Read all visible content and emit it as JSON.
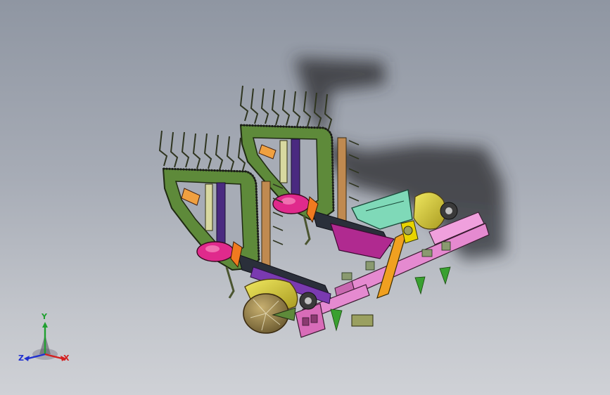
{
  "triad": {
    "x_label": "X",
    "y_label": "Y",
    "z_label": "Z",
    "x_color": "#d42020",
    "y_color": "#20a030",
    "z_color": "#2030d0"
  },
  "model": {
    "frame_color": "#5e8a3a",
    "outline_color": "#1f2a12",
    "chassis_color": "#e58ad0",
    "tine_color": "#4b5530",
    "belt_color": "#2a2f3a",
    "accent_yellow": "#e8d400",
    "accent_magenta": "#e02a8c",
    "accent_orange": "#f07a20",
    "accent_teal": "#7fd9b8",
    "accent_purple": "#7a3ab0",
    "shadow_color": "#2e2f33"
  }
}
